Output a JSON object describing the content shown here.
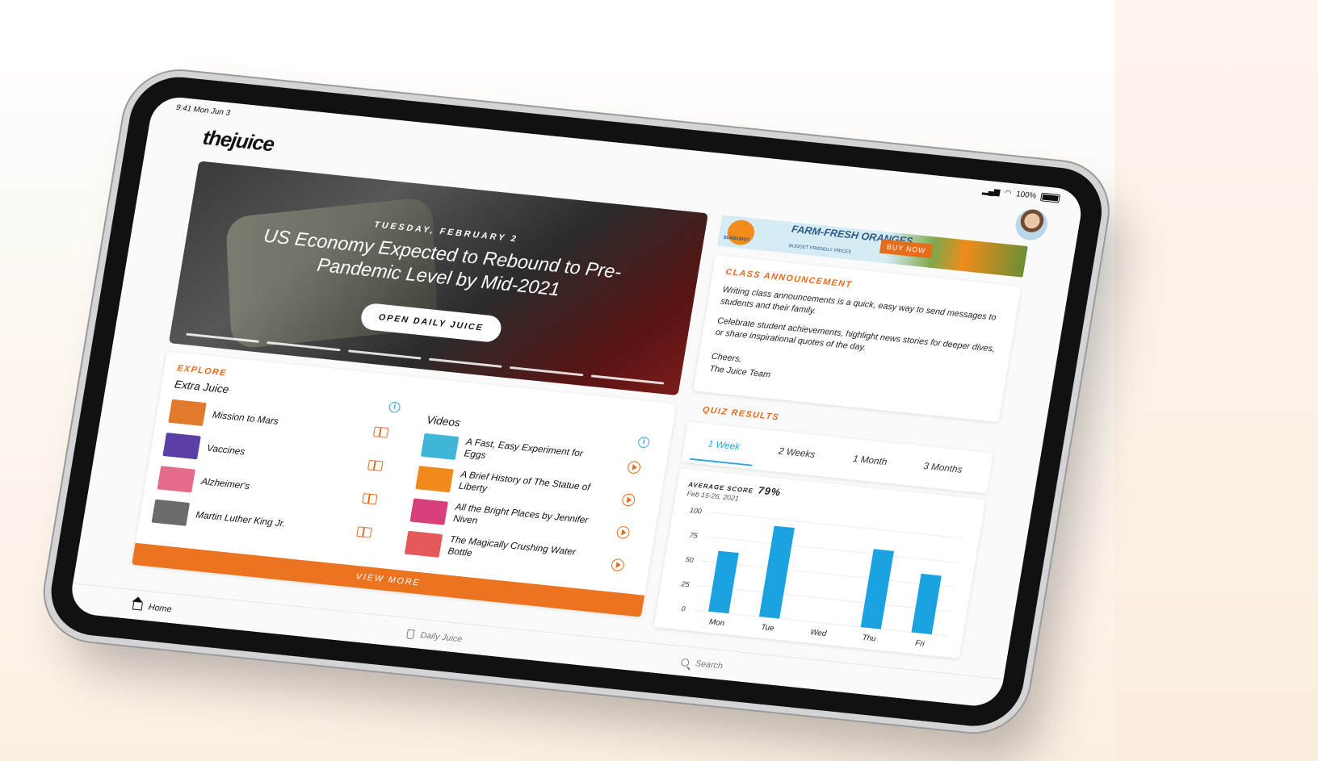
{
  "status": {
    "time": "9:41 Mon Jun 3",
    "battery": "100%"
  },
  "app": {
    "logo": "thejuice"
  },
  "hero": {
    "date": "TUESDAY, FEBRUARY 2",
    "title": "US Economy Expected to Rebound to Pre-Pandemic Level by Mid-2021",
    "button": "OPEN DAILY JUICE"
  },
  "ad": {
    "brand": "SUNBURST",
    "headline": "FARM-FRESH ORANGES.",
    "tagline": "BUDGET FRIENDLY PRICES",
    "button": "BUY NOW"
  },
  "announcement": {
    "heading": "CLASS ANNOUNCEMENT",
    "p1": "Writing class announcements is a quick, easy way to send messages to students and their family.",
    "p2": "Celebrate student achievements, highlight news stories for deeper dives, or share inspirational quotes of the day.",
    "p3": "Cheers,",
    "p4": "The Juice Team"
  },
  "explore": {
    "heading": "EXPLORE",
    "extra_title": "Extra Juice",
    "videos_title": "Videos",
    "extra_items": [
      {
        "label": "Mission to Mars",
        "color": "#e27a2c"
      },
      {
        "label": "Vaccines",
        "color": "#5a3fa8"
      },
      {
        "label": "Alzheimer's",
        "color": "#e46c8a"
      },
      {
        "label": "Martin Luther King Jr.",
        "color": "#6b6b6b"
      }
    ],
    "videos": [
      {
        "label": "A Fast, Easy Experiment for Eggs",
        "color": "#3fb6d8"
      },
      {
        "label": "A Brief History of The Statue of Liberty",
        "color": "#f08a1c"
      },
      {
        "label": "All the Bright Places by Jennifer Niven",
        "color": "#d63f7a"
      },
      {
        "label": "The Magically Crushing Water Bottle",
        "color": "#e45a5a"
      }
    ],
    "view_more": "VIEW MORE"
  },
  "quiz": {
    "heading": "QUIZ RESULTS",
    "tabs": [
      "1 Week",
      "2 Weeks",
      "1 Month",
      "3 Months"
    ],
    "active_tab": "1 Week",
    "avg_label": "AVERAGE SCORE",
    "avg_value": "79%",
    "range": "Feb 15-26, 2021"
  },
  "chart_data": {
    "type": "bar",
    "categories": [
      "Mon",
      "Tue",
      "Wed",
      "Thu",
      "Fri"
    ],
    "values": [
      62,
      93,
      0,
      80,
      60
    ],
    "yticks": [
      0,
      25,
      50,
      75,
      100
    ],
    "ylim": [
      0,
      100
    ],
    "color": "#1aa3e0"
  },
  "tabbar": {
    "home": "Home",
    "daily_juice": "Daily Juice",
    "search": "Search"
  }
}
